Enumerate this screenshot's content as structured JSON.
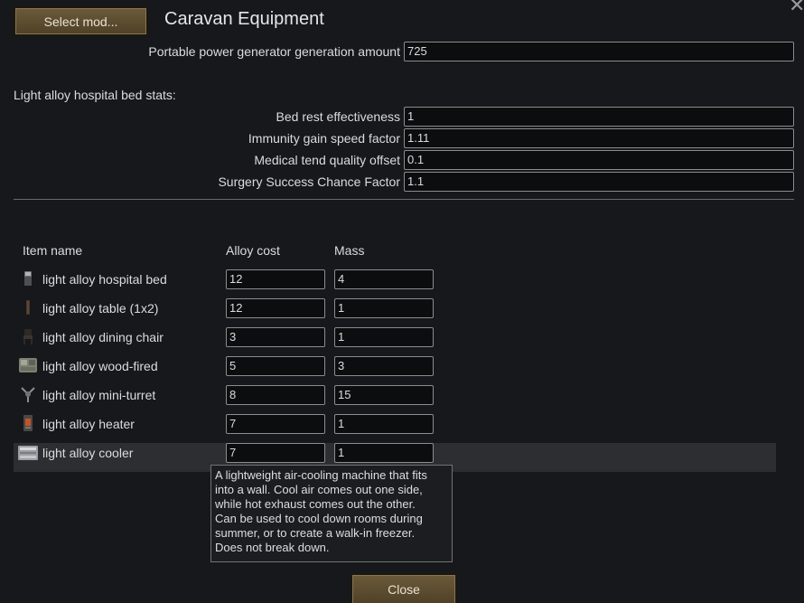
{
  "toolbar": {
    "select_mod_label": "Select mod..."
  },
  "header": {
    "title": "Caravan Equipment"
  },
  "settings": {
    "generator": {
      "label": "Portable power generator generation amount",
      "value": "725"
    },
    "bed_section_label": "Light alloy hospital bed stats:",
    "bed_stats": [
      {
        "label": "Bed rest effectiveness",
        "value": "1"
      },
      {
        "label": "Immunity gain speed factor",
        "value": "1.11"
      },
      {
        "label": "Medical tend quality offset",
        "value": "0.1"
      },
      {
        "label": "Surgery Success Chance Factor",
        "value": "1.1"
      }
    ]
  },
  "table": {
    "headers": {
      "name": "Item name",
      "cost": "Alloy cost",
      "mass": "Mass"
    },
    "rows": [
      {
        "name": "light alloy hospital bed",
        "cost": "12",
        "mass": "4",
        "icon": "hospital-bed-icon"
      },
      {
        "name": "light alloy table (1x2)",
        "cost": "12",
        "mass": "1",
        "icon": "table-icon"
      },
      {
        "name": "light alloy dining chair",
        "cost": "3",
        "mass": "1",
        "icon": "dining-chair-icon"
      },
      {
        "name": "light alloy wood-fired",
        "cost": "5",
        "mass": "3",
        "icon": "wood-fired-generator-icon"
      },
      {
        "name": "light alloy mini-turret",
        "cost": "8",
        "mass": "15",
        "icon": "mini-turret-icon"
      },
      {
        "name": "light alloy heater",
        "cost": "7",
        "mass": "1",
        "icon": "heater-icon"
      },
      {
        "name": "light alloy cooler",
        "cost": "7",
        "mass": "1",
        "icon": "cooler-icon"
      }
    ]
  },
  "tooltip": {
    "text": "A lightweight air-cooling machine that fits\ninto a wall. Cool air comes out one side,\nwhile hot exhaust comes out the other.\nCan be used to cool down rooms during\nsummer, or to create a walk-in freezer.\nDoes not break down."
  },
  "footer": {
    "close_label": "Close"
  },
  "window": {
    "close_glyph": "✕"
  },
  "colors": {
    "background": "#16181b",
    "button_brown": "#5e4e32",
    "field_bg": "#0c0d0f",
    "highlight_row": "#2c2e31"
  }
}
